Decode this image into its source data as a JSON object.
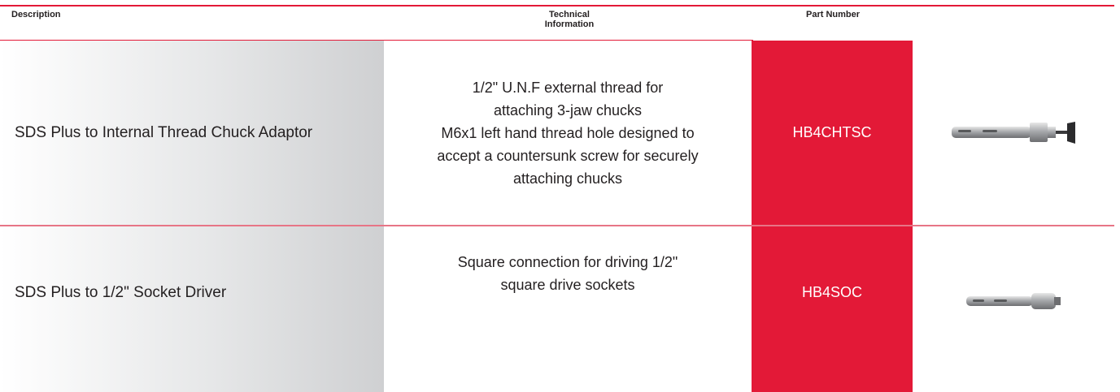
{
  "header": {
    "description": "Description",
    "technical_information": "Technical\nInformation",
    "part_number": "Part Number"
  },
  "rows": [
    {
      "description": "SDS Plus to Internal Thread Chuck Adaptor",
      "technical_information": "1/2\" U.N.F external thread for\nattaching 3-jaw chucks\nM6x1 left hand thread hole designed to\naccept a countersunk screw for securely\nattaching chucks",
      "part_number": "HB4CHTSC",
      "image": "chuck-adaptor-image"
    },
    {
      "description": "SDS Plus to 1/2\" Socket Driver",
      "technical_information": "Square connection for driving 1/2\"\nsquare drive sockets",
      "part_number": "HB4SOC",
      "image": "socket-driver-image"
    }
  ],
  "colors": {
    "accent_red": "#e31937",
    "text": "#231f20",
    "gray_gradient_end": "#cfd0d2"
  }
}
